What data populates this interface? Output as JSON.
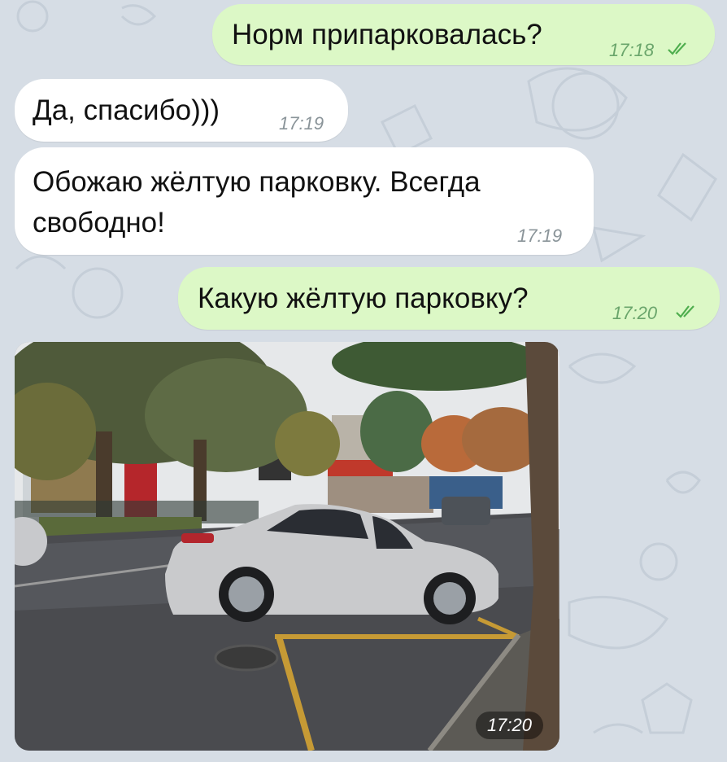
{
  "messages": [
    {
      "text": "Норм припарковалась?",
      "time": "17:18",
      "direction": "outgoing",
      "status": "read"
    },
    {
      "text": "Да, спасибо)))",
      "time": "17:19",
      "direction": "incoming"
    },
    {
      "text_line1": "Обожаю жёлтую парковку. Всегда",
      "text_line2": "свободно!",
      "time": "17:19",
      "direction": "incoming"
    },
    {
      "text": "Какую жёлтую парковку?",
      "time": "17:20",
      "direction": "outgoing",
      "status": "read"
    },
    {
      "type": "photo",
      "time": "17:20",
      "direction": "incoming"
    }
  ],
  "colors": {
    "outgoing_bubble": "#dcf8c6",
    "incoming_bubble": "#ffffff",
    "background": "#d6dde5",
    "check": "#4fae4e"
  },
  "icons": [
    "double-check-icon"
  ]
}
